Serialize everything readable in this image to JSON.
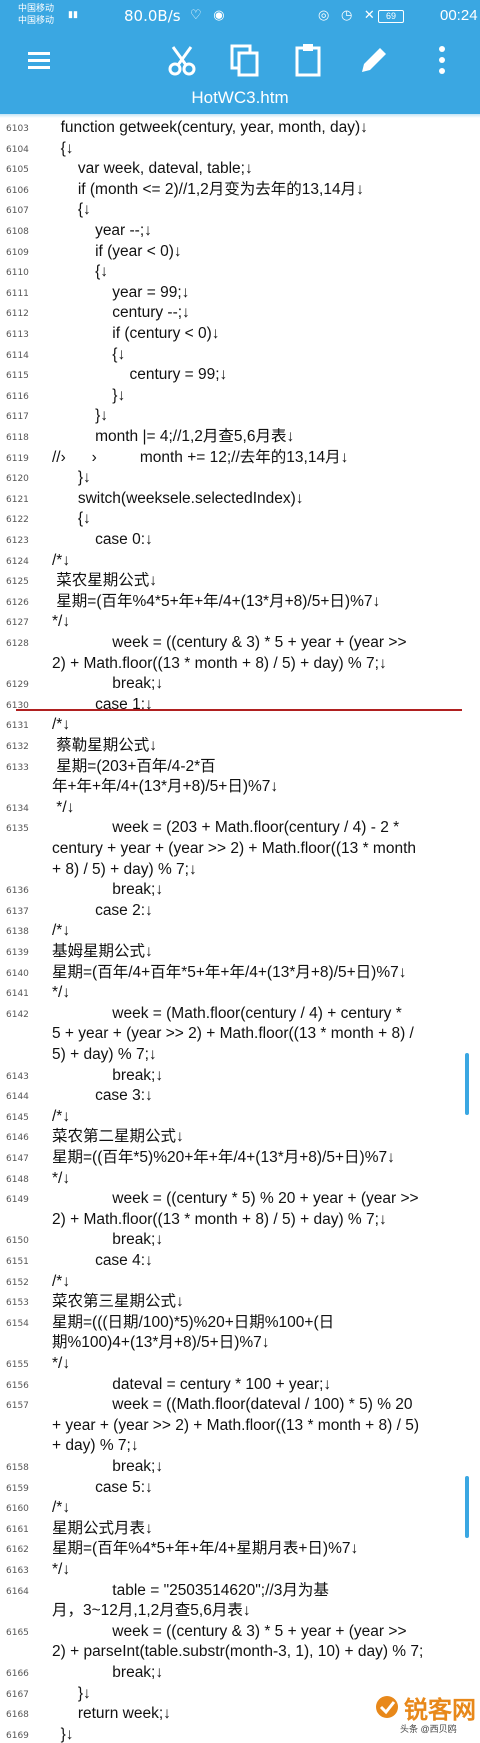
{
  "status": {
    "carrier1": "中国移动",
    "carrier2": "中国移动",
    "speed": "80.0B/s",
    "battery": "69",
    "time": "00:24"
  },
  "toolbar": {
    "title": "HotWC3.htm",
    "icons": [
      "menu-icon",
      "cut-icon",
      "copy-icon",
      "paste-icon",
      "edit-icon",
      "more-icon"
    ]
  },
  "lines": [
    {
      "n": "6103",
      "t": "  function getweek(century, year, month, day)↓"
    },
    {
      "n": "6104",
      "t": "  {↓"
    },
    {
      "n": "6105",
      "t": "      var week, dateval, table;↓"
    },
    {
      "n": "6106",
      "t": "      if (month <= 2)//1,2月变为去年的13,14月↓"
    },
    {
      "n": "6107",
      "t": "      {↓"
    },
    {
      "n": "6108",
      "t": "          year --;↓"
    },
    {
      "n": "6109",
      "t": "          if (year < 0)↓"
    },
    {
      "n": "6110",
      "t": "          {↓"
    },
    {
      "n": "6111",
      "t": "              year = 99;↓"
    },
    {
      "n": "6112",
      "t": "              century --;↓"
    },
    {
      "n": "6113",
      "t": "              if (century < 0)↓"
    },
    {
      "n": "6114",
      "t": "              {↓"
    },
    {
      "n": "6115",
      "t": "                  century = 99;↓"
    },
    {
      "n": "6116",
      "t": "              }↓"
    },
    {
      "n": "6117",
      "t": "          }↓"
    },
    {
      "n": "6118",
      "t": "          month |= 4;//1,2月查5,6月表↓"
    },
    {
      "n": "6119",
      "t": "//›      ›          month += 12;//去年的13,14月↓"
    },
    {
      "n": "6120",
      "t": "      }↓"
    },
    {
      "n": "6121",
      "t": "      switch(weeksele.selectedIndex)↓"
    },
    {
      "n": "6122",
      "t": "      {↓"
    },
    {
      "n": "6123",
      "t": "          case 0:↓"
    },
    {
      "n": "6124",
      "t": "/*↓"
    },
    {
      "n": "6125",
      "t": " 菜农星期公式↓"
    },
    {
      "n": "6126",
      "t": " 星期=(百年%4*5+年+年/4+(13*月+8)/5+日)%7↓"
    },
    {
      "n": "6127",
      "t": "*/↓"
    },
    {
      "n": "6128",
      "t": "              week = ((century & 3) * 5 + year + (year >>"
    },
    {
      "n": "",
      "t": "2) + Math.floor((13 * month + 8) / 5) + day) % 7;↓"
    },
    {
      "n": "6129",
      "t": "              break;↓"
    },
    {
      "n": "6130",
      "t": "          case 1:↓"
    },
    {
      "n": "6131",
      "t": "/*↓"
    },
    {
      "n": "6132",
      "t": " 蔡勒星期公式↓"
    },
    {
      "n": "6133",
      "t": " 星期=(203+百年/4-2*百"
    },
    {
      "n": "",
      "t": "年+年+年/4+(13*月+8)/5+日)%7↓"
    },
    {
      "n": "6134",
      "t": " */↓"
    },
    {
      "n": "6135",
      "t": "              week = (203 + Math.floor(century / 4) - 2 *"
    },
    {
      "n": "",
      "t": "century + year + (year >> 2) + Math.floor((13 * month"
    },
    {
      "n": "",
      "t": "+ 8) / 5) + day) % 7;↓"
    },
    {
      "n": "6136",
      "t": "              break;↓"
    },
    {
      "n": "6137",
      "t": "          case 2:↓"
    },
    {
      "n": "6138",
      "t": "/*↓"
    },
    {
      "n": "6139",
      "t": "基姆星期公式↓"
    },
    {
      "n": "6140",
      "t": "星期=(百年/4+百年*5+年+年/4+(13*月+8)/5+日)%7↓"
    },
    {
      "n": "6141",
      "t": "*/↓"
    },
    {
      "n": "6142",
      "t": "              week = (Math.floor(century / 4) + century *"
    },
    {
      "n": "",
      "t": "5 + year + (year >> 2) + Math.floor((13 * month + 8) /"
    },
    {
      "n": "",
      "t": "5) + day) % 7;↓"
    },
    {
      "n": "6143",
      "t": "              break;↓"
    },
    {
      "n": "6144",
      "t": "          case 3:↓"
    },
    {
      "n": "6145",
      "t": "/*↓"
    },
    {
      "n": "6146",
      "t": "菜农第二星期公式↓"
    },
    {
      "n": "6147",
      "t": "星期=((百年*5)%20+年+年/4+(13*月+8)/5+日)%7↓"
    },
    {
      "n": "6148",
      "t": "*/↓"
    },
    {
      "n": "6149",
      "t": "              week = ((century * 5) % 20 + year + (year >>"
    },
    {
      "n": "",
      "t": "2) + Math.floor((13 * month + 8) / 5) + day) % 7;↓"
    },
    {
      "n": "6150",
      "t": "              break;↓"
    },
    {
      "n": "6151",
      "t": "          case 4:↓"
    },
    {
      "n": "6152",
      "t": "/*↓"
    },
    {
      "n": "6153",
      "t": "菜农第三星期公式↓"
    },
    {
      "n": "6154",
      "t": "星期=(((日期/100)*5)%20+日期%100+(日"
    },
    {
      "n": "",
      "t": "期%100)4+(13*月+8)/5+日)%7↓"
    },
    {
      "n": "6155",
      "t": "*/↓"
    },
    {
      "n": "6156",
      "t": "              dateval = century * 100 + year;↓"
    },
    {
      "n": "6157",
      "t": "              week = ((Math.floor(dateval / 100) * 5) % 20"
    },
    {
      "n": "",
      "t": "+ year + (year >> 2) + Math.floor((13 * month + 8) / 5)"
    },
    {
      "n": "",
      "t": "+ day) % 7;↓"
    },
    {
      "n": "6158",
      "t": "              break;↓"
    },
    {
      "n": "6159",
      "t": "          case 5:↓"
    },
    {
      "n": "6160",
      "t": "/*↓"
    },
    {
      "n": "6161",
      "t": "星期公式月表↓"
    },
    {
      "n": "6162",
      "t": "星期=(百年%4*5+年+年/4+星期月表+日)%7↓"
    },
    {
      "n": "6163",
      "t": "*/↓"
    },
    {
      "n": "6164",
      "t": "              table = \"2503514620\";//3月为基"
    },
    {
      "n": "",
      "t": "月，3~12月,1,2月查5,6月表↓"
    },
    {
      "n": "6165",
      "t": "              week = ((century & 3) * 5 + year + (year >>"
    },
    {
      "n": "",
      "t": "2) + parseInt(table.substr(month-3, 1), 10) + day) % 7;"
    },
    {
      "n": "6166",
      "t": "              break;↓"
    },
    {
      "n": "6167",
      "t": "      }↓"
    },
    {
      "n": "6168",
      "t": "      return week;↓"
    },
    {
      "n": "6169",
      "t": "  }↓"
    }
  ],
  "watermark": {
    "text": "锐客网",
    "sub": "头条 @西贝鸥"
  }
}
